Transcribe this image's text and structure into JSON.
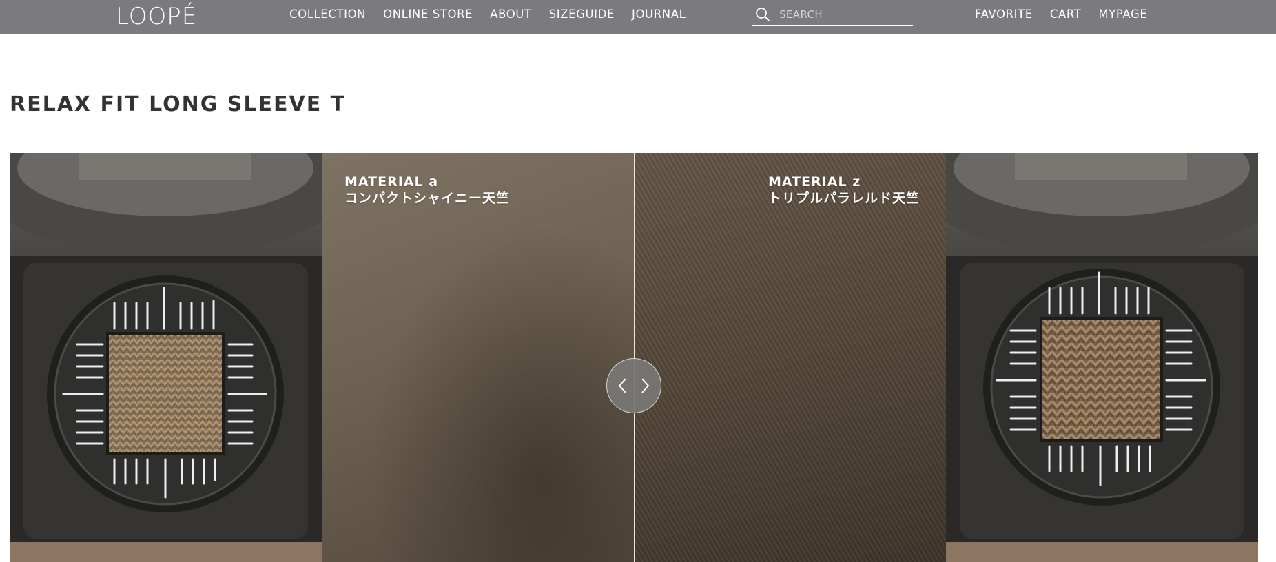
{
  "header": {
    "logo": "LOOPÉ",
    "nav": [
      "COLLECTION",
      "ONLINE STORE",
      "ABOUT",
      "SIZEGUIDE",
      "JOURNAL"
    ],
    "search_placeholder": "SEARCH",
    "utility": [
      "FAVORITE",
      "CART",
      "MYPAGE"
    ]
  },
  "page": {
    "title": "RELAX FIT LONG SLEEVE T"
  },
  "comparison": {
    "left": {
      "name": "MATERIAL a",
      "fabric": "コンパクトシャイニー天竺"
    },
    "right": {
      "name": "MATERIAL z",
      "fabric": "トリプルパラレルド天竺"
    },
    "slider_position": 0.5
  },
  "icons": {
    "search": "search-icon",
    "handle_left": "chevron-left-icon",
    "handle_right": "chevron-right-icon"
  },
  "colors": {
    "header_bg": "#7b7a7f",
    "title_text": "#333333"
  }
}
